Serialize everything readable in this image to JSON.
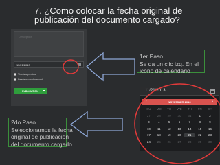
{
  "slide": {
    "title_line1": "7. ¿Como colocar la fecha original de",
    "title_line2": "publicación del documento cargado?"
  },
  "upload_form": {
    "description_placeholder": "Description",
    "date_value": "11/21/2013",
    "preview_label": "This is a preview",
    "download_label": "Readers can download",
    "publish_label": "PUBLICATION"
  },
  "notes": {
    "step1": [
      "1er Paso.",
      "Se da un clic izq. En el",
      "icono de calendario"
    ],
    "step2": [
      "2do Paso.",
      "Seleccionamos la fecha",
      "original de publicación",
      "del documento cargado."
    ]
  },
  "calendar": {
    "date_value": "11/21/2013",
    "month_label": "NOVEMBER 2013",
    "prev_arrow": "‹",
    "next_arrow": "›",
    "weekdays": [
      "SU",
      "MO",
      "TU",
      "WE",
      "TH",
      "FR",
      "SA"
    ],
    "days": [
      "27",
      "28",
      "29",
      "30",
      "31",
      "1",
      "2",
      "3",
      "4",
      "5",
      "6",
      "7",
      "8",
      "9",
      "10",
      "11",
      "12",
      "13",
      "14",
      "15",
      "16",
      "17",
      "18",
      "19",
      "20",
      "21",
      "22",
      "23",
      "24",
      "25",
      "26",
      "27",
      "28",
      "29",
      "30"
    ],
    "muted_indices": [
      0,
      1,
      2,
      3,
      4,
      29,
      30,
      31,
      32,
      33,
      34
    ],
    "today_index": 25
  },
  "colors": {
    "background": "#2a2c2e",
    "accent_red": "#d9534f",
    "publish_green": "#2f9e3c",
    "note_border": "#3b8f3b",
    "annotation_circle": "#e23a3a"
  },
  "icons": {
    "calendar": "calendar-icon",
    "arrows": "annotation-arrow"
  }
}
